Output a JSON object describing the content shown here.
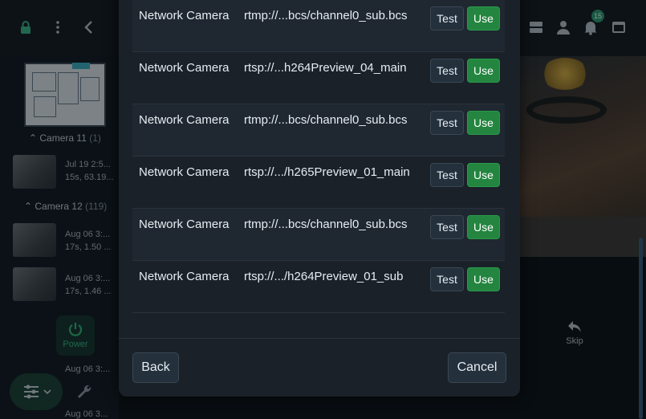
{
  "notifications": {
    "count": "15"
  },
  "sidebar": {
    "groups": [
      {
        "name": "Camera 11",
        "count": "(1)"
      },
      {
        "name": "Camera 12",
        "count": "(119)"
      }
    ],
    "items": [
      {
        "time": "Jul 19 2:5...",
        "meta": "15s, 63.19..."
      },
      {
        "time": "Aug 06 3:...",
        "meta": "17s, 1.50 ..."
      },
      {
        "time": "Aug 06 3:...",
        "meta": "17s, 1.46 ..."
      },
      {
        "time": "Aug 06 3:...",
        "meta": ""
      },
      {
        "time": "Aug 06 3...",
        "meta": ""
      }
    ],
    "power_label": "Power"
  },
  "player": {
    "skip_label": "Skip"
  },
  "dialog": {
    "streams": [
      {
        "type": "Network Camera",
        "url": "rtmp://...bcs/channel0_sub.bcs",
        "test": "Test",
        "use": "Use"
      },
      {
        "type": "Network Camera",
        "url": "rtsp://...h264Preview_04_main",
        "test": "Test",
        "use": "Use"
      },
      {
        "type": "Network Camera",
        "url": "rtmp://...bcs/channel0_sub.bcs",
        "test": "Test",
        "use": "Use"
      },
      {
        "type": "Network Camera",
        "url": "rtsp://.../h265Preview_01_main",
        "test": "Test",
        "use": "Use"
      },
      {
        "type": "Network Camera",
        "url": "rtmp://...bcs/channel0_sub.bcs",
        "test": "Test",
        "use": "Use"
      },
      {
        "type": "Network Camera",
        "url": "rtsp://.../h264Preview_01_sub",
        "test": "Test",
        "use": "Use"
      }
    ],
    "back_label": "Back",
    "cancel_label": "Cancel"
  },
  "colors": {
    "accent_green": "#23853f",
    "background": "#0c1116",
    "dialog": "#1a2129"
  }
}
